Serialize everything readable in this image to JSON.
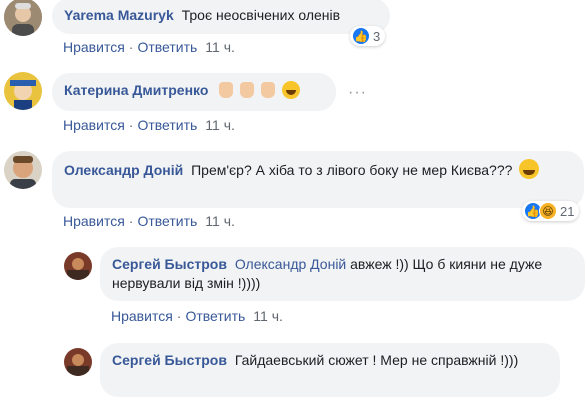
{
  "actions": {
    "like": "Нравится",
    "reply": "Ответить",
    "sep": "·"
  },
  "comments": [
    {
      "author": "Yarema Mazuryk",
      "text": "Троє неосвічених оленів",
      "time": "11 ч.",
      "reaction_count": "3"
    },
    {
      "author": "Катерина Дмитренко",
      "text": "",
      "time": "11 ч.",
      "more": "···"
    },
    {
      "author": "Олександр Доній",
      "text": "Прем'єр? А хіба то з лівого боку не мер Києва???",
      "time": "11 ч.",
      "reaction_count": "21"
    },
    {
      "author": "Сергей Быстров",
      "mention": "Олександр Доній",
      "text": "авжеж !)) Що б кияни не дуже нервували від змін !))))",
      "time": "11 ч."
    },
    {
      "author": "Сергей Быстров",
      "text": "Гайдаевський сюжет ! Мер не справжній !)))"
    }
  ],
  "icons": {
    "like": "like-reaction-icon",
    "haha": "haha-reaction-icon",
    "thumbs": "thumbs-up-emoji-icon"
  }
}
